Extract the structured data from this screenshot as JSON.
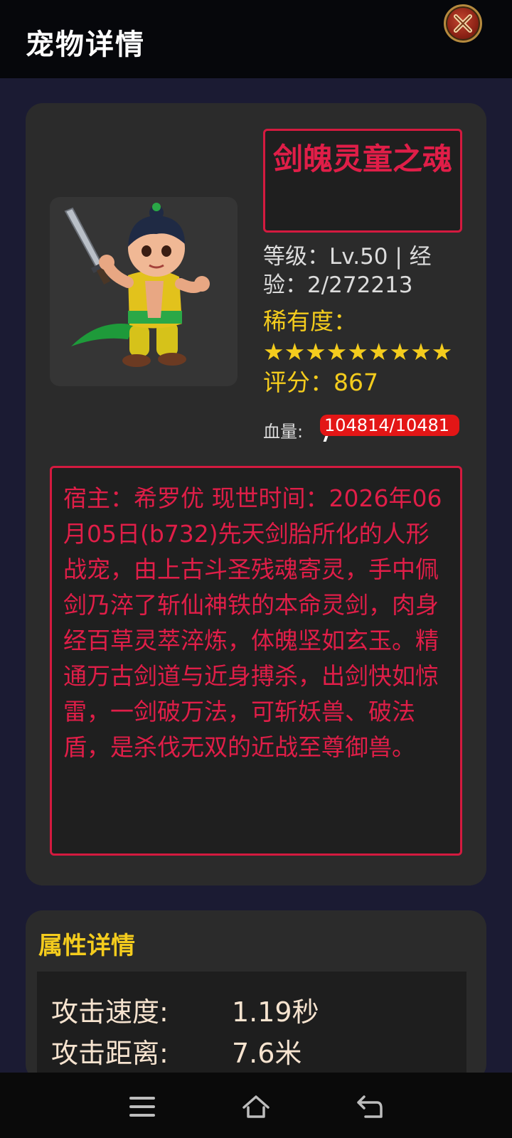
{
  "header": {
    "title": "宠物详情",
    "close_icon": "close-x-icon"
  },
  "pet": {
    "name": "剑魄灵童之魂",
    "level_text": "等级：Lv.50 | 经验：2/272213",
    "rarity_label": "稀有度：",
    "rarity_stars": "★★★★★★★★★",
    "rarity_star_count": 9,
    "score_text": " 评分：867",
    "hp_label": "血量:",
    "hp_text": "104814/10481",
    "hp_fraction": 1.0,
    "description": "宿主：希罗优 现世时间：2026年06月05日(b732)先天剑胎所化的人形战宠，由上古斗圣残魂寄灵，手中佩剑乃淬了斩仙神铁的本命灵剑，肉身经百草灵萃淬炼，体魄坚如玄玉。精通万古剑道与近身搏杀，出剑快如惊雷，一剑破万法，可斩妖兽、破法盾，是杀伐无双的近战至尊御兽。",
    "image_icon": "sword-child-warrior-icon"
  },
  "attributes": {
    "section_title": "属性详情",
    "rows": [
      {
        "label": "攻击速度:",
        "value": "1.19秒"
      },
      {
        "label": "攻击距离:",
        "value": "7.6米"
      }
    ]
  },
  "navbar": {
    "menu_icon": "menu-icon",
    "home_icon": "home-icon",
    "back_icon": "back-icon"
  },
  "colors": {
    "accent_red": "#e01e48",
    "gold": "#f4cc1d",
    "hp_red": "#e31616",
    "card_bg": "#2b2b2b",
    "page_bg": "#1b1b33"
  }
}
